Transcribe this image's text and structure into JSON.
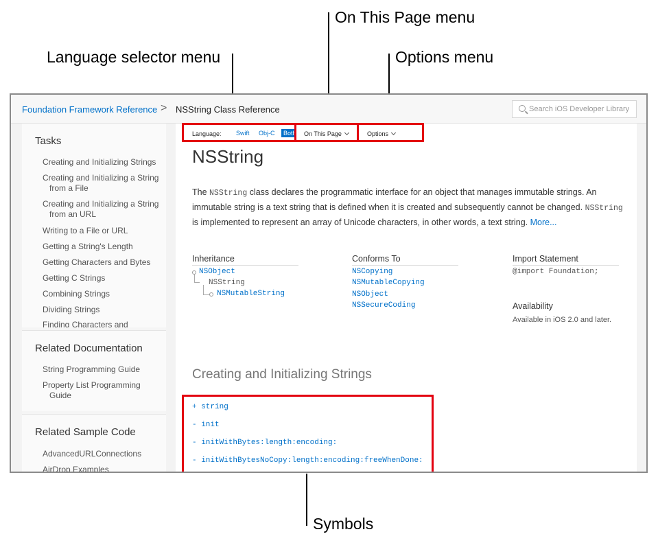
{
  "callouts": {
    "on_this_page": "On This Page menu",
    "language_selector": "Language selector menu",
    "options": "Options menu",
    "symbols": "Symbols"
  },
  "breadcrumb": {
    "framework": "Foundation Framework Reference",
    "separator": ">",
    "current": "NSString Class Reference"
  },
  "search": {
    "placeholder": "Search iOS Developer Library"
  },
  "toolbar": {
    "language_label": "Language:",
    "languages": [
      "Swift",
      "Obj-C",
      "Both"
    ],
    "selected_language": "Both",
    "on_this_page": "On This Page",
    "options": "Options"
  },
  "sidebar": {
    "tasks_title": "Tasks",
    "tasks": [
      "Creating and Initializing Strings",
      "Creating and Initializing a String from a File",
      "Creating and Initializing a String from an URL",
      "Writing to a File or URL",
      "Getting a String's Length",
      "Getting Characters and Bytes",
      "Getting C Strings",
      "Combining Strings",
      "Dividing Strings",
      "Finding Characters and"
    ],
    "related_docs_title": "Related Documentation",
    "related_docs": [
      "String Programming Guide",
      "Property List Programming Guide"
    ],
    "related_code_title": "Related Sample Code",
    "related_code": [
      "AdvancedURLConnections",
      "AirDrop Examples"
    ]
  },
  "main": {
    "title": "NSString",
    "desc_the": "The ",
    "desc_class": "NSString",
    "desc_part1": " class declares the programmatic interface for an object that manages immutable strings. An immutable string is a text string that is defined when it is created and subsequently cannot be changed. ",
    "desc_class2": "NSString",
    "desc_part2": " is implemented to represent an array of Unicode characters, in other words, a text string. ",
    "desc_more": "More...",
    "inheritance_title": "Inheritance",
    "inheritance": [
      "NSObject",
      "NSString",
      "NSMutableString"
    ],
    "conforms_title": "Conforms To",
    "conforms": [
      "NSCopying",
      "NSMutableCopying",
      "NSObject",
      "NSSecureCoding"
    ],
    "import_title": "Import Statement",
    "import_value": "@import Foundation;",
    "availability_title": "Availability",
    "availability_value": "Available in iOS 2.0 and later.",
    "section_title": "Creating and Initializing Strings",
    "symbols": [
      "+ string",
      "- init",
      "- initWithBytes:length:encoding:",
      "- initWithBytesNoCopy:length:encoding:freeWhenDone:"
    ]
  }
}
